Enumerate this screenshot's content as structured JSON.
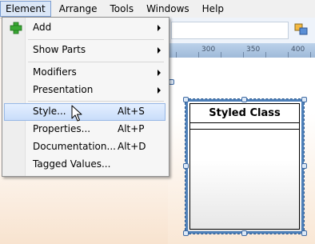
{
  "menubar": {
    "items": [
      {
        "label": "Element"
      },
      {
        "label": "Arrange"
      },
      {
        "label": "Tools"
      },
      {
        "label": "Windows"
      },
      {
        "label": "Help"
      }
    ]
  },
  "dropdown": {
    "items": [
      {
        "label": "Add",
        "shortcut": "",
        "submenu": true,
        "icon": "green-plus-icon"
      },
      {
        "label": "Show Parts",
        "shortcut": "",
        "submenu": true
      },
      {
        "label": "Modifiers",
        "shortcut": "",
        "submenu": true
      },
      {
        "label": "Presentation",
        "shortcut": "",
        "submenu": true
      },
      {
        "label": "Style...",
        "shortcut": "Alt+S",
        "submenu": false,
        "highlighted": true
      },
      {
        "label": "Properties...",
        "shortcut": "Alt+P",
        "submenu": false
      },
      {
        "label": "Documentation...",
        "shortcut": "Alt+D",
        "submenu": false
      },
      {
        "label": "Tagged Values...",
        "shortcut": "",
        "submenu": false
      }
    ]
  },
  "ruler": {
    "labels": [
      "300",
      "350",
      "400"
    ]
  },
  "diagram": {
    "class_name": "Styled Class"
  },
  "colors": {
    "highlight": "#c9ddfa",
    "selection_border": "#4d7fb8",
    "add_icon": "#3aa834"
  }
}
